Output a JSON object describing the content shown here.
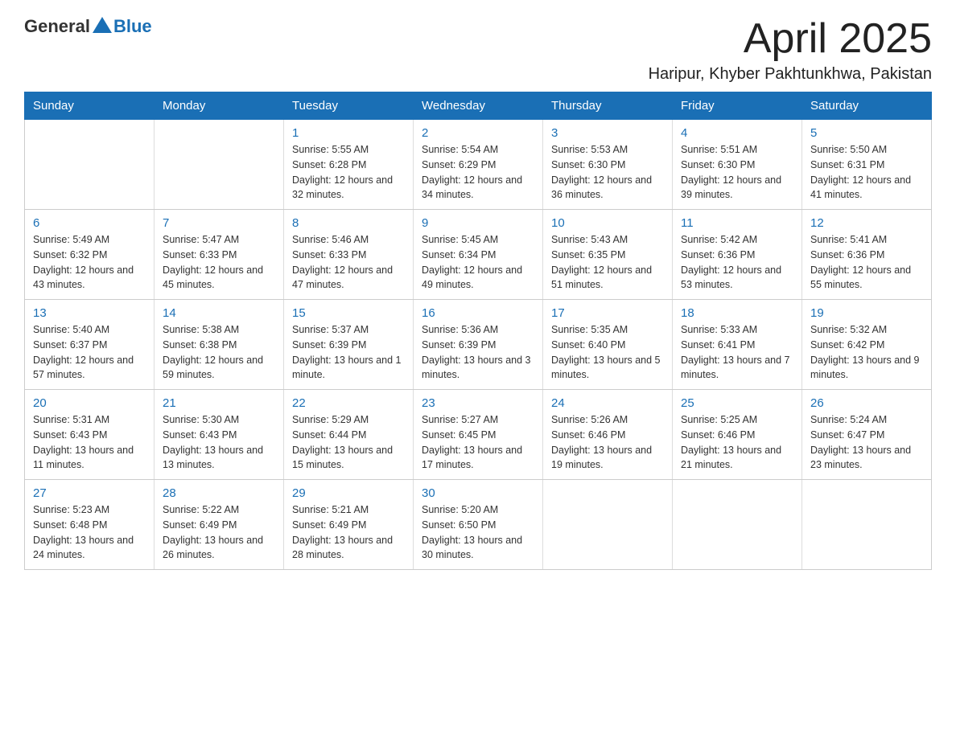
{
  "header": {
    "logo_general": "General",
    "logo_blue": "Blue",
    "title_month": "April 2025",
    "title_location": "Haripur, Khyber Pakhtunkhwa, Pakistan"
  },
  "weekdays": [
    "Sunday",
    "Monday",
    "Tuesday",
    "Wednesday",
    "Thursday",
    "Friday",
    "Saturday"
  ],
  "weeks": [
    [
      {
        "day": "",
        "sunrise": "",
        "sunset": "",
        "daylight": ""
      },
      {
        "day": "",
        "sunrise": "",
        "sunset": "",
        "daylight": ""
      },
      {
        "day": "1",
        "sunrise": "5:55 AM",
        "sunset": "6:28 PM",
        "daylight": "12 hours and 32 minutes."
      },
      {
        "day": "2",
        "sunrise": "5:54 AM",
        "sunset": "6:29 PM",
        "daylight": "12 hours and 34 minutes."
      },
      {
        "day": "3",
        "sunrise": "5:53 AM",
        "sunset": "6:30 PM",
        "daylight": "12 hours and 36 minutes."
      },
      {
        "day": "4",
        "sunrise": "5:51 AM",
        "sunset": "6:30 PM",
        "daylight": "12 hours and 39 minutes."
      },
      {
        "day": "5",
        "sunrise": "5:50 AM",
        "sunset": "6:31 PM",
        "daylight": "12 hours and 41 minutes."
      }
    ],
    [
      {
        "day": "6",
        "sunrise": "5:49 AM",
        "sunset": "6:32 PM",
        "daylight": "12 hours and 43 minutes."
      },
      {
        "day": "7",
        "sunrise": "5:47 AM",
        "sunset": "6:33 PM",
        "daylight": "12 hours and 45 minutes."
      },
      {
        "day": "8",
        "sunrise": "5:46 AM",
        "sunset": "6:33 PM",
        "daylight": "12 hours and 47 minutes."
      },
      {
        "day": "9",
        "sunrise": "5:45 AM",
        "sunset": "6:34 PM",
        "daylight": "12 hours and 49 minutes."
      },
      {
        "day": "10",
        "sunrise": "5:43 AM",
        "sunset": "6:35 PM",
        "daylight": "12 hours and 51 minutes."
      },
      {
        "day": "11",
        "sunrise": "5:42 AM",
        "sunset": "6:36 PM",
        "daylight": "12 hours and 53 minutes."
      },
      {
        "day": "12",
        "sunrise": "5:41 AM",
        "sunset": "6:36 PM",
        "daylight": "12 hours and 55 minutes."
      }
    ],
    [
      {
        "day": "13",
        "sunrise": "5:40 AM",
        "sunset": "6:37 PM",
        "daylight": "12 hours and 57 minutes."
      },
      {
        "day": "14",
        "sunrise": "5:38 AM",
        "sunset": "6:38 PM",
        "daylight": "12 hours and 59 minutes."
      },
      {
        "day": "15",
        "sunrise": "5:37 AM",
        "sunset": "6:39 PM",
        "daylight": "13 hours and 1 minute."
      },
      {
        "day": "16",
        "sunrise": "5:36 AM",
        "sunset": "6:39 PM",
        "daylight": "13 hours and 3 minutes."
      },
      {
        "day": "17",
        "sunrise": "5:35 AM",
        "sunset": "6:40 PM",
        "daylight": "13 hours and 5 minutes."
      },
      {
        "day": "18",
        "sunrise": "5:33 AM",
        "sunset": "6:41 PM",
        "daylight": "13 hours and 7 minutes."
      },
      {
        "day": "19",
        "sunrise": "5:32 AM",
        "sunset": "6:42 PM",
        "daylight": "13 hours and 9 minutes."
      }
    ],
    [
      {
        "day": "20",
        "sunrise": "5:31 AM",
        "sunset": "6:43 PM",
        "daylight": "13 hours and 11 minutes."
      },
      {
        "day": "21",
        "sunrise": "5:30 AM",
        "sunset": "6:43 PM",
        "daylight": "13 hours and 13 minutes."
      },
      {
        "day": "22",
        "sunrise": "5:29 AM",
        "sunset": "6:44 PM",
        "daylight": "13 hours and 15 minutes."
      },
      {
        "day": "23",
        "sunrise": "5:27 AM",
        "sunset": "6:45 PM",
        "daylight": "13 hours and 17 minutes."
      },
      {
        "day": "24",
        "sunrise": "5:26 AM",
        "sunset": "6:46 PM",
        "daylight": "13 hours and 19 minutes."
      },
      {
        "day": "25",
        "sunrise": "5:25 AM",
        "sunset": "6:46 PM",
        "daylight": "13 hours and 21 minutes."
      },
      {
        "day": "26",
        "sunrise": "5:24 AM",
        "sunset": "6:47 PM",
        "daylight": "13 hours and 23 minutes."
      }
    ],
    [
      {
        "day": "27",
        "sunrise": "5:23 AM",
        "sunset": "6:48 PM",
        "daylight": "13 hours and 24 minutes."
      },
      {
        "day": "28",
        "sunrise": "5:22 AM",
        "sunset": "6:49 PM",
        "daylight": "13 hours and 26 minutes."
      },
      {
        "day": "29",
        "sunrise": "5:21 AM",
        "sunset": "6:49 PM",
        "daylight": "13 hours and 28 minutes."
      },
      {
        "day": "30",
        "sunrise": "5:20 AM",
        "sunset": "6:50 PM",
        "daylight": "13 hours and 30 minutes."
      },
      {
        "day": "",
        "sunrise": "",
        "sunset": "",
        "daylight": ""
      },
      {
        "day": "",
        "sunrise": "",
        "sunset": "",
        "daylight": ""
      },
      {
        "day": "",
        "sunrise": "",
        "sunset": "",
        "daylight": ""
      }
    ]
  ]
}
